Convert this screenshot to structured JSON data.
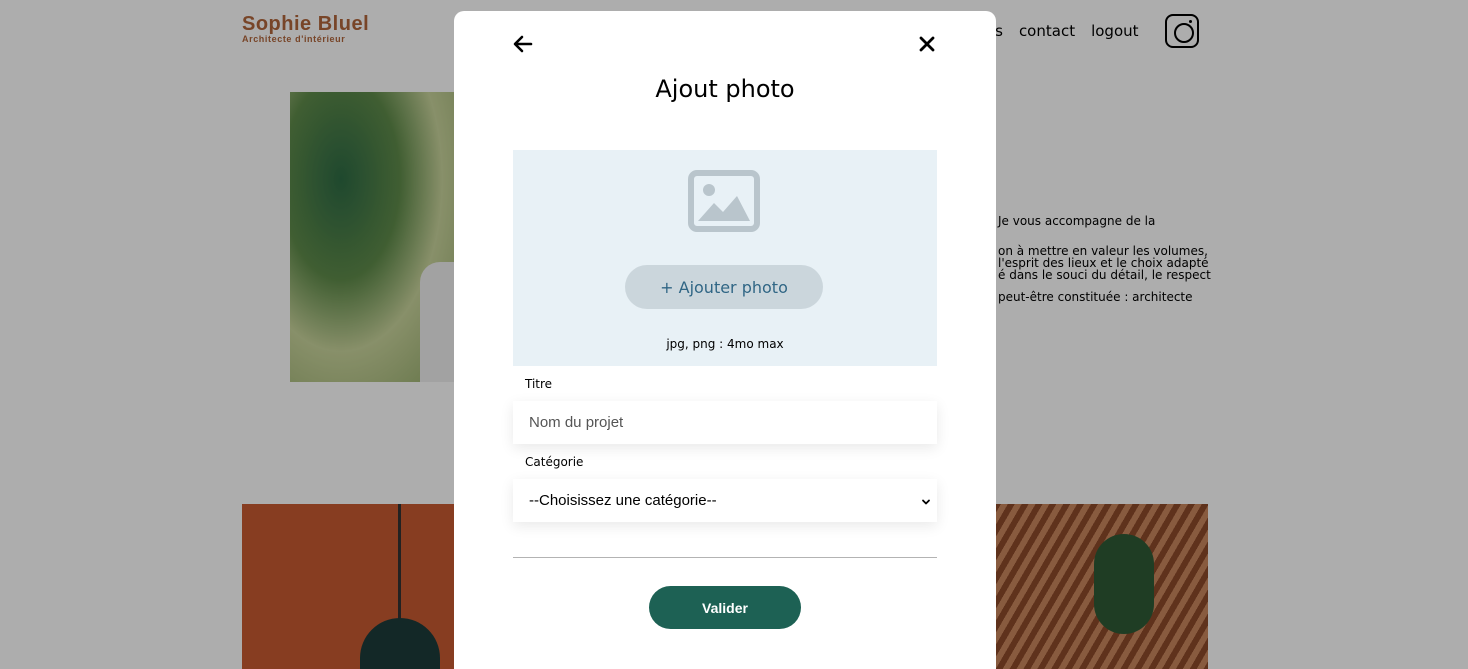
{
  "header": {
    "logo_name": "Sophie Bluel",
    "logo_subtitle": "Architecte d'intérieur",
    "nav": [
      "ets",
      "contact",
      "logout"
    ],
    "instagram_icon": "instagram-icon"
  },
  "about": {
    "lines": [
      "Je vous accompagne de la",
      "on à mettre en valeur les volumes,",
      "l'esprit des lieux et le choix adapté",
      "é dans le souci du détail, le respect",
      "peut-être constituée : architecte"
    ]
  },
  "modal": {
    "title": "Ajout photo",
    "back_icon": "arrow-left-icon",
    "close_icon": "close-icon",
    "upload": {
      "icon": "image-icon",
      "button_label": "+ Ajouter photo",
      "hint": "jpg, png : 4mo max"
    },
    "title_field": {
      "label": "Titre",
      "placeholder": "Nom du projet"
    },
    "category_field": {
      "label": "Catégorie",
      "selected": "--Choisissez une catégorie--"
    },
    "submit_label": "Valider"
  },
  "colors": {
    "brand": "#b1663c",
    "accent": "#1d6154",
    "upload_bg": "#e8f1f6",
    "upload_button_text": "#306685",
    "upload_button_bg": "#cbd6dc"
  }
}
